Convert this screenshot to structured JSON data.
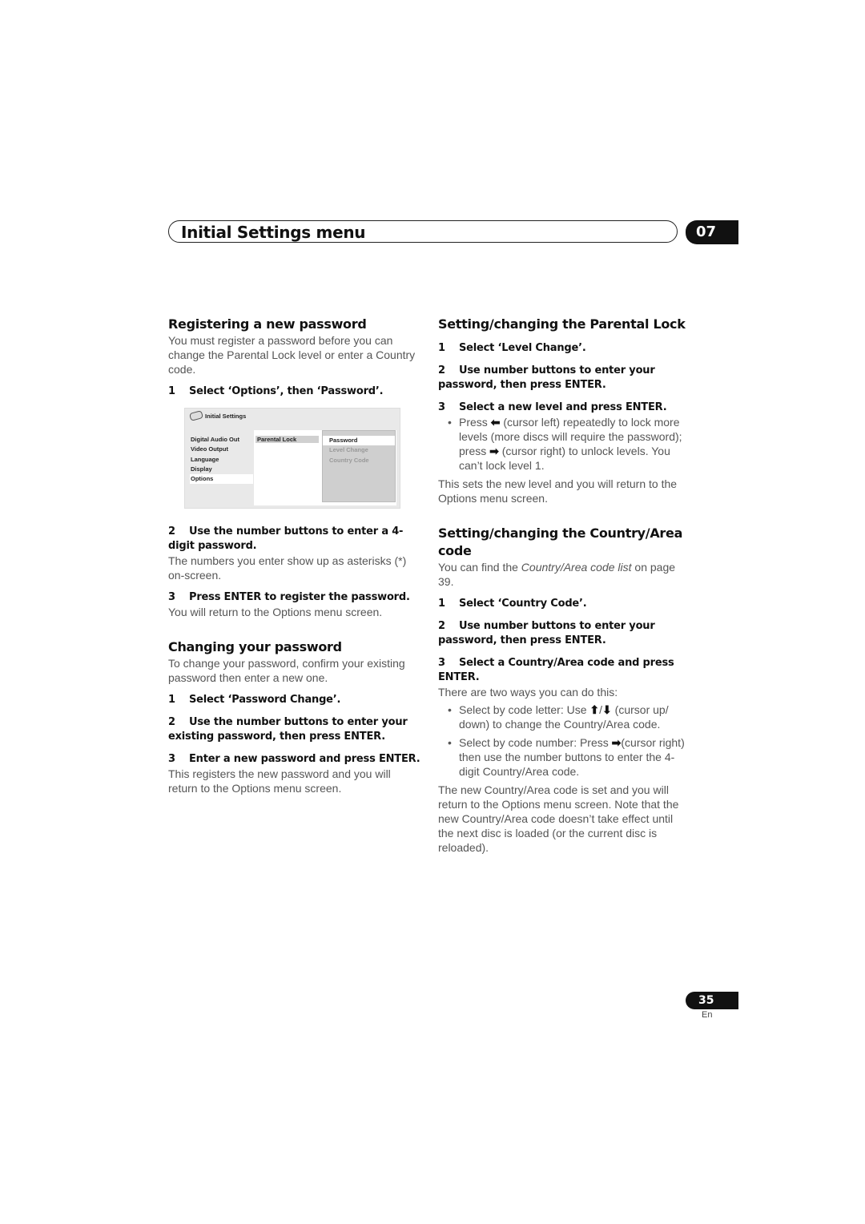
{
  "header": {
    "title": "Initial Settings menu",
    "chapter": "07"
  },
  "left_column": {
    "register": {
      "heading": "Registering a new password",
      "intro": "You must register a password before you can change the Parental Lock level or enter a Country code.",
      "step1": {
        "num": "1",
        "text": "Select ‘Options’, then ‘Password’."
      },
      "osd": {
        "title": "Initial Settings",
        "left_menu": [
          "Digital Audio Out",
          "Video Output",
          "Language",
          "Display",
          "Options"
        ],
        "selected_left": "Options",
        "mid_item": "Parental Lock",
        "right_items": [
          "Password",
          "Level Change",
          "Country Code"
        ],
        "selected_right": "Password"
      },
      "step2": {
        "num": "2",
        "text": "Use the number buttons to enter a 4-digit password."
      },
      "step2_body": "The numbers you enter show up as asterisks (*) on-screen.",
      "step3": {
        "num": "3",
        "text": "Press ENTER to register the password."
      },
      "step3_body": "You will return to the Options menu screen."
    },
    "change": {
      "heading": "Changing your password",
      "intro": "To change your password, confirm your existing password then enter a new one.",
      "step1": {
        "num": "1",
        "text": "Select ‘Password Change’."
      },
      "step2": {
        "num": "2",
        "text": "Use the number buttons to enter your existing password, then press ENTER."
      },
      "step3": {
        "num": "3",
        "text": "Enter a new password and press ENTER."
      },
      "step3_body": "This registers the new password and you will return to the Options menu screen."
    }
  },
  "right_column": {
    "parental": {
      "heading": "Setting/changing the Parental Lock",
      "step1": {
        "num": "1",
        "text": "Select ‘Level Change’."
      },
      "step2": {
        "num": "2",
        "text": "Use number buttons to enter your password, then press ENTER."
      },
      "step3": {
        "num": "3",
        "text": "Select a new level and press ENTER."
      },
      "bullet": {
        "a": "Press",
        "left_arrow": "⬅",
        "b": "(cursor left) repeatedly to lock more levels (more discs will require the password); press",
        "right_arrow": "➡",
        "c": "(cursor right) to unlock levels. You can’t lock level 1."
      },
      "outro": "This sets the new level and you will return to the Options menu screen."
    },
    "country": {
      "heading": "Setting/changing the Country/Area code",
      "intro_a": "You can find the",
      "intro_link": "Country/Area code list",
      "intro_b": "on page 39.",
      "step1": {
        "num": "1",
        "text": "Select ‘Country Code’."
      },
      "step2": {
        "num": "2",
        "text": "Use number buttons to enter your password, then press ENTER."
      },
      "step3": {
        "num": "3",
        "text": "Select a Country/Area code and press ENTER."
      },
      "step3_body": "There are two ways you can do this:",
      "bullet1": {
        "a": "Select by code letter: Use",
        "up": "⬆",
        "sep": "/",
        "down": "⬇",
        "b": "(cursor up/ down) to change the Country/Area code."
      },
      "bullet2": {
        "a": "Select by code number: Press",
        "right": "➡",
        "b": "(cursor right) then use the number buttons to enter the 4-digit Country/Area code."
      },
      "outro": "The new Country/Area code is set and you will return to the Options menu screen. Note that the new Country/Area code doesn’t take effect until the next disc is loaded (or the current disc is reloaded)."
    }
  },
  "footer": {
    "page_number": "35",
    "language": "En"
  }
}
